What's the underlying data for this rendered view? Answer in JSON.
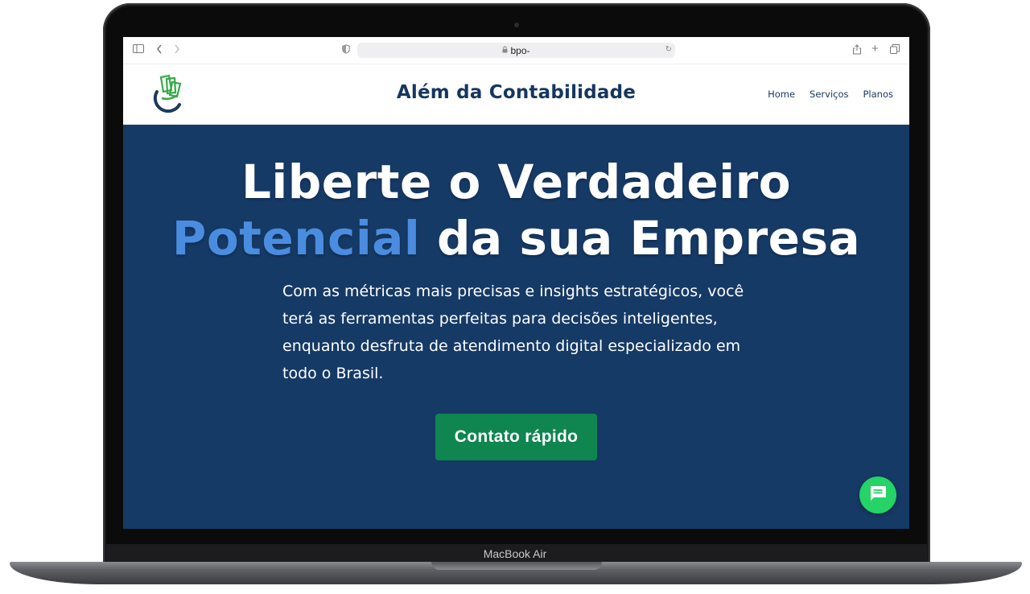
{
  "device": {
    "model_label": "MacBook Air"
  },
  "browser": {
    "url": "bpo-",
    "icons": {
      "sidebar": "sidebar-icon",
      "back": "chevron-left-icon",
      "forward": "chevron-right-icon",
      "privacy": "shield-icon",
      "lock": "lock-icon",
      "reload": "reload-icon",
      "share": "share-icon",
      "new_tab": "plus-icon",
      "tabs": "tabs-icon"
    }
  },
  "site": {
    "title": "Além da Contabilidade",
    "nav": [
      {
        "label": "Home"
      },
      {
        "label": "Serviços"
      },
      {
        "label": "Planos"
      }
    ]
  },
  "hero": {
    "headline_line1": "Liberte o Verdadeiro",
    "headline_accent": "Potencial",
    "headline_rest": " da sua Empresa",
    "body": "Com as métricas mais precisas e insights estratégicos, você terá as ferramentas perfeitas para decisões inteligentes, enquanto desfruta de atendimento digital especializado em todo o Brasil.",
    "cta_label": "Contato rápido"
  },
  "colors": {
    "hero_bg": "#163a66",
    "accent": "#4a8de0",
    "cta": "#0f8550",
    "brand_text": "#15365f",
    "chat": "#25d366"
  }
}
